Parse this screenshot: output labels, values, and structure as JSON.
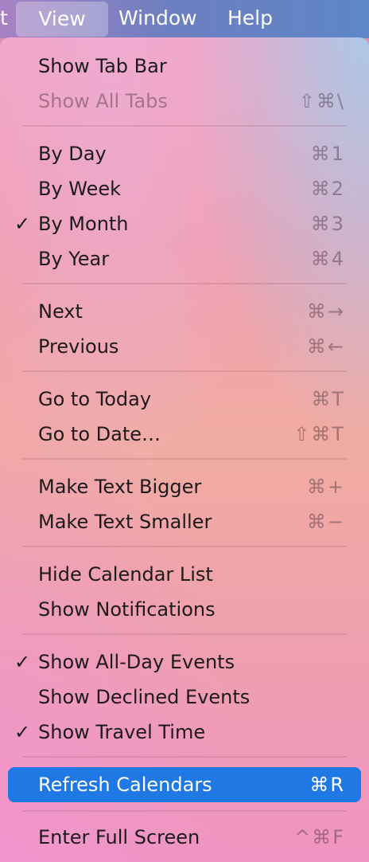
{
  "menubar": {
    "items": [
      {
        "label": "t"
      },
      {
        "label": "View"
      },
      {
        "label": "Window"
      },
      {
        "label": "Help"
      }
    ]
  },
  "menu": {
    "items": [
      {
        "label": "Show Tab Bar",
        "shortcut": "",
        "checked": false,
        "enabled": true
      },
      {
        "label": "Show All Tabs",
        "shortcut": "⇧⌘\\",
        "checked": false,
        "enabled": false
      },
      {
        "label": "By Day",
        "shortcut": "⌘1",
        "checked": false,
        "enabled": true
      },
      {
        "label": "By Week",
        "shortcut": "⌘2",
        "checked": false,
        "enabled": true
      },
      {
        "label": "By Month",
        "shortcut": "⌘3",
        "checked": true,
        "enabled": true
      },
      {
        "label": "By Year",
        "shortcut": "⌘4",
        "checked": false,
        "enabled": true
      },
      {
        "label": "Next",
        "shortcut": "⌘→",
        "checked": false,
        "enabled": true
      },
      {
        "label": "Previous",
        "shortcut": "⌘←",
        "checked": false,
        "enabled": true
      },
      {
        "label": "Go to Today",
        "shortcut": "⌘T",
        "checked": false,
        "enabled": true
      },
      {
        "label": "Go to Date…",
        "shortcut": "⇧⌘T",
        "checked": false,
        "enabled": true
      },
      {
        "label": "Make Text Bigger",
        "shortcut": "⌘+",
        "checked": false,
        "enabled": true
      },
      {
        "label": "Make Text Smaller",
        "shortcut": "⌘−",
        "checked": false,
        "enabled": true
      },
      {
        "label": "Hide Calendar List",
        "shortcut": "",
        "checked": false,
        "enabled": true
      },
      {
        "label": "Show Notifications",
        "shortcut": "",
        "checked": false,
        "enabled": true
      },
      {
        "label": "Show All-Day Events",
        "shortcut": "",
        "checked": true,
        "enabled": true
      },
      {
        "label": "Show Declined Events",
        "shortcut": "",
        "checked": false,
        "enabled": true
      },
      {
        "label": "Show Travel Time",
        "shortcut": "",
        "checked": true,
        "enabled": true
      },
      {
        "label": "Refresh Calendars",
        "shortcut": "⌘R",
        "checked": false,
        "enabled": true,
        "highlighted": true
      },
      {
        "label": "Enter Full Screen",
        "shortcut": "^⌘F",
        "checked": false,
        "enabled": true
      }
    ],
    "check_glyph": "✓"
  },
  "colors": {
    "highlight": "#1f78e3",
    "menubar": "#6d7fc0"
  }
}
